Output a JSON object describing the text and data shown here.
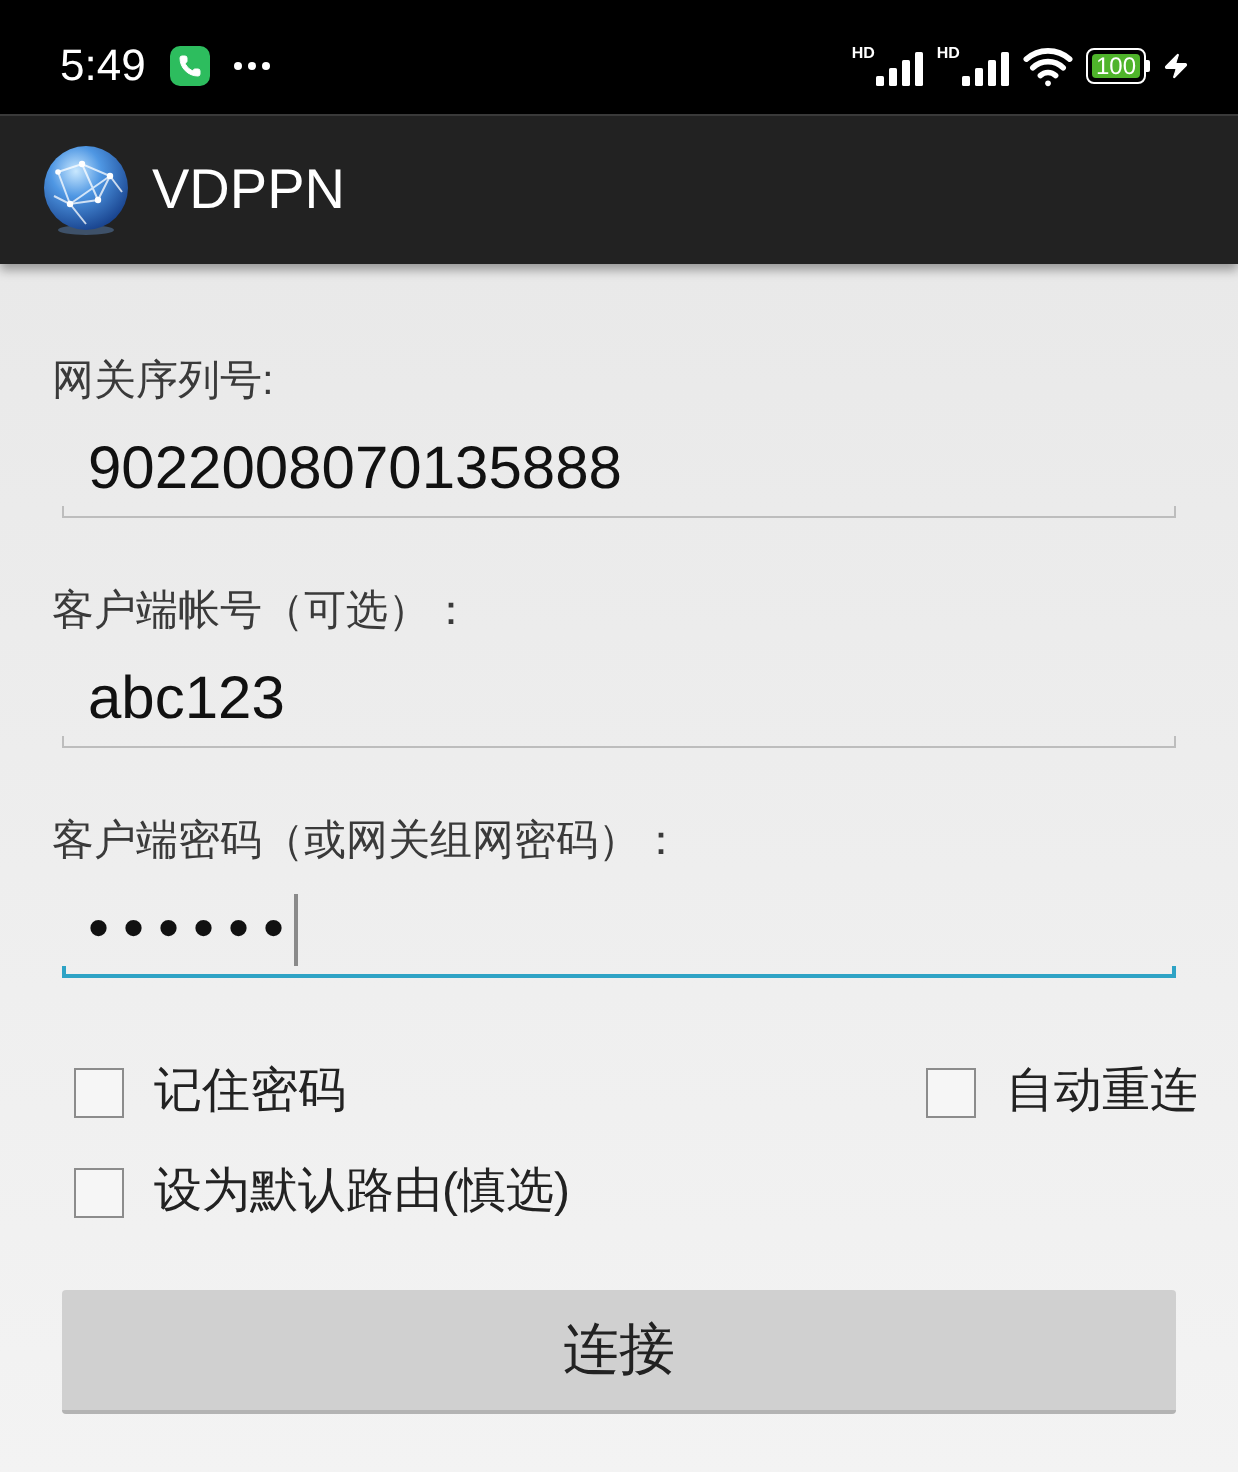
{
  "status_bar": {
    "time": "5:49",
    "signals": [
      {
        "badge": "HD"
      },
      {
        "badge": "HD"
      }
    ],
    "battery": {
      "label": "100",
      "charging": true
    }
  },
  "app_bar": {
    "title": "VDPPN"
  },
  "form": {
    "fields": [
      {
        "label": "网关序列号:",
        "kind": "text",
        "value": "9022008070135888",
        "focused": false
      },
      {
        "label": "客户端帐号（可选）：",
        "kind": "text",
        "value": "abc123",
        "focused": false
      },
      {
        "label": "客户端密码（或网关组网密码）：",
        "kind": "password",
        "value": "••••••",
        "focused": true
      }
    ],
    "checkbox_rows": [
      [
        {
          "label": "记住密码",
          "checked": false
        },
        {
          "label": "自动重连",
          "checked": false
        }
      ],
      [
        {
          "label": "设为默认路由(慎选)",
          "checked": false
        }
      ]
    ],
    "button": {
      "label": "连接"
    }
  }
}
